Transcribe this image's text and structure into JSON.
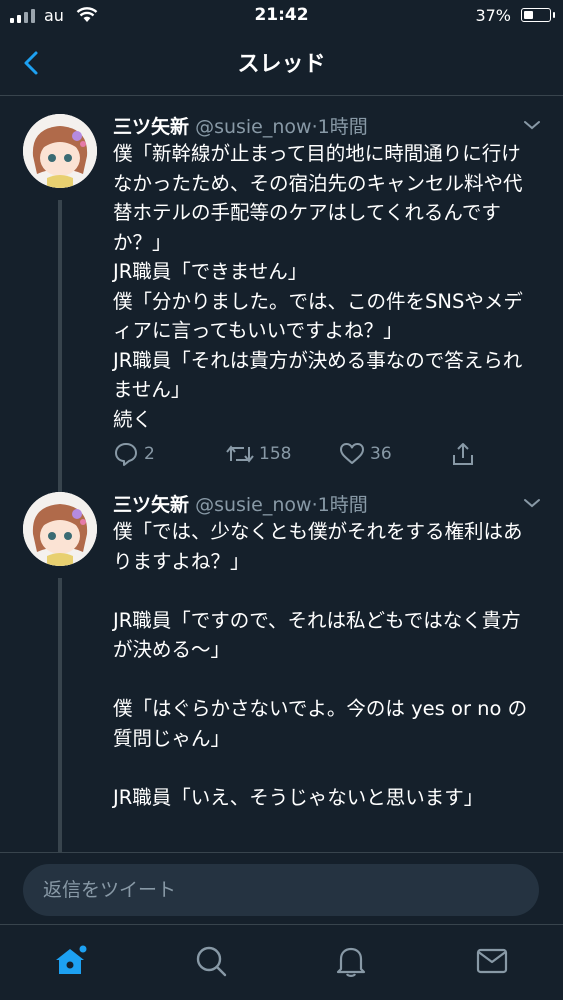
{
  "status_bar": {
    "carrier": "au",
    "time": "21:42",
    "battery_percent": "37%",
    "battery_level": 0.37
  },
  "header": {
    "title": "スレッド"
  },
  "tweets": [
    {
      "name": "三ツ矢新",
      "handle": "@susie_now",
      "dot": "·",
      "time": "1時間",
      "text": "僕「新幹線が止まって目的地に時間通りに行けなかったため、その宿泊先のキャンセル料や代替ホテルの手配等のケアはしてくれるんですか？」\nJR職員「できません」\n僕「分かりました。では、この件をSNSやメディアに言ってもいいですよね？」\nJR職員「それは貴方が決める事なので答えられません」\n続く",
      "replies": "2",
      "retweets": "158",
      "likes": "36"
    },
    {
      "name": "三ツ矢新",
      "handle": "@susie_now",
      "dot": "·",
      "time": "1時間",
      "text": "僕「では、少なくとも僕がそれをする権利はありますよね？」\n\nJR職員「ですので、それは私どもではなく貴方が決める〜」\n\n僕「はぐらかさないでよ。今のは yes or no の質問じゃん」\n\nJR職員「いえ、そうじゃないと思います」"
    }
  ],
  "reply_bar": {
    "placeholder": "返信をツイート"
  },
  "colors": {
    "background": "#15202b",
    "accent": "#1da1f2",
    "secondary_text": "#8899a6",
    "divider": "#38444d"
  },
  "icons": {
    "back": "chevron-left-icon",
    "reply": "comment-icon",
    "retweet": "retweet-icon",
    "like": "heart-icon",
    "share": "share-icon",
    "home": "home-icon",
    "search": "search-icon",
    "notifications": "bell-icon",
    "messages": "mail-icon"
  }
}
